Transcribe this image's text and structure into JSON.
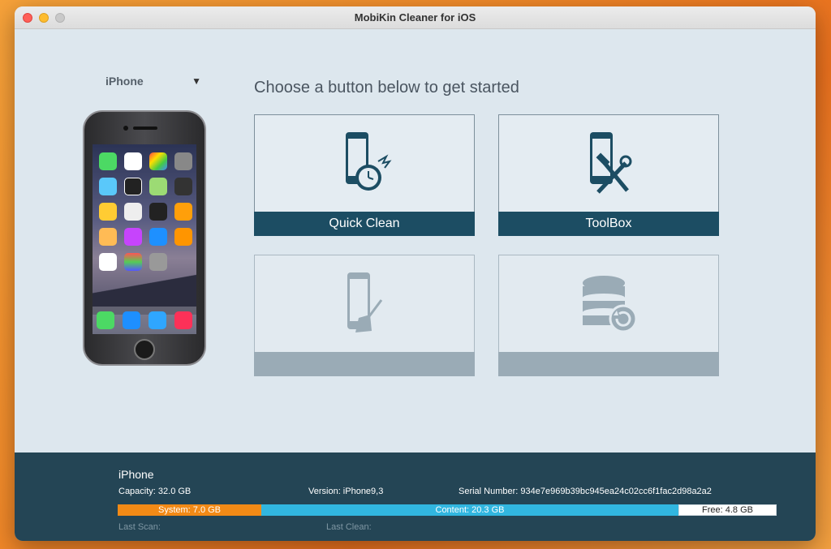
{
  "window": {
    "title": "MobiKin Cleaner for iOS"
  },
  "device_select": {
    "value": "iPhone"
  },
  "main": {
    "heading": "Choose a button below to get started",
    "tiles": [
      {
        "label": "Quick Clean",
        "icon": "phone-clock-icon",
        "enabled": true
      },
      {
        "label": "ToolBox",
        "icon": "phone-tools-icon",
        "enabled": true
      },
      {
        "label": "",
        "icon": "phone-broom-icon",
        "enabled": false
      },
      {
        "label": "",
        "icon": "database-restore-icon",
        "enabled": false
      }
    ]
  },
  "footer": {
    "device_name": "iPhone",
    "capacity": "Capacity: 32.0 GB",
    "version": "Version: iPhone9,3",
    "serial": "Serial Number: 934e7e969b39bc945ea24c02cc6f1fac2d98a2a2",
    "storage": {
      "system": {
        "label": "System: 7.0 GB",
        "value_gb": 7.0,
        "color": "#f28a16"
      },
      "content": {
        "label": "Content: 20.3 GB",
        "value_gb": 20.3,
        "color": "#31b6e0"
      },
      "free": {
        "label": "Free: 4.8 GB",
        "value_gb": 4.8,
        "color": "#ffffff"
      }
    },
    "last_scan": "Last Scan:",
    "last_clean": "Last Clean:"
  },
  "colors": {
    "accent": "#1c4d63",
    "footer_bg": "#244555",
    "window_bg": "#dde7ee"
  }
}
